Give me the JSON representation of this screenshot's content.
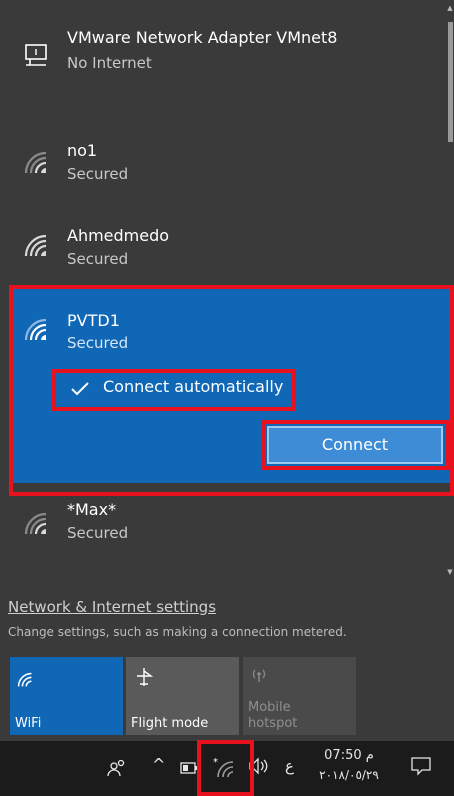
{
  "networks": [
    {
      "name": "VMware Network Adapter VMnet8",
      "status": "No Internet",
      "icon": "ethernet-icon"
    },
    {
      "name": "no1",
      "status": "Secured",
      "icon": "wifi-icon"
    },
    {
      "name": "Ahmedmedo",
      "status": "Secured",
      "icon": "wifi-icon"
    },
    {
      "name": "PVTD1",
      "status": "Secured",
      "icon": "wifi-icon",
      "selected": true
    },
    {
      "name": "*Max*",
      "status": "Secured",
      "icon": "wifi-icon"
    }
  ],
  "selected_network": {
    "connect_auto_label": "Connect automatically",
    "connect_auto_checked": true,
    "connect_button": "Connect"
  },
  "settings": {
    "link": "Network & Internet settings",
    "description": "Change settings, such as making a connection metered."
  },
  "quick_actions": [
    {
      "label": "WiFi",
      "icon": "wifi-icon",
      "active": true
    },
    {
      "label": "Flight mode",
      "icon": "airplane-icon",
      "active": false
    },
    {
      "label_line1": "Mobile",
      "label_line2": "hotspot",
      "icon": "hotspot-icon",
      "active": false,
      "disabled": true
    }
  ],
  "taskbar": {
    "time": "07:50 م",
    "date": "٢٠١٨/٠٥/٢٩",
    "language": "ع"
  },
  "colors": {
    "panel_bg": "#3a3a3a",
    "accent": "#0f67b6",
    "highlight_border": "#e8121e",
    "taskbar_bg": "#1b1b1b"
  }
}
